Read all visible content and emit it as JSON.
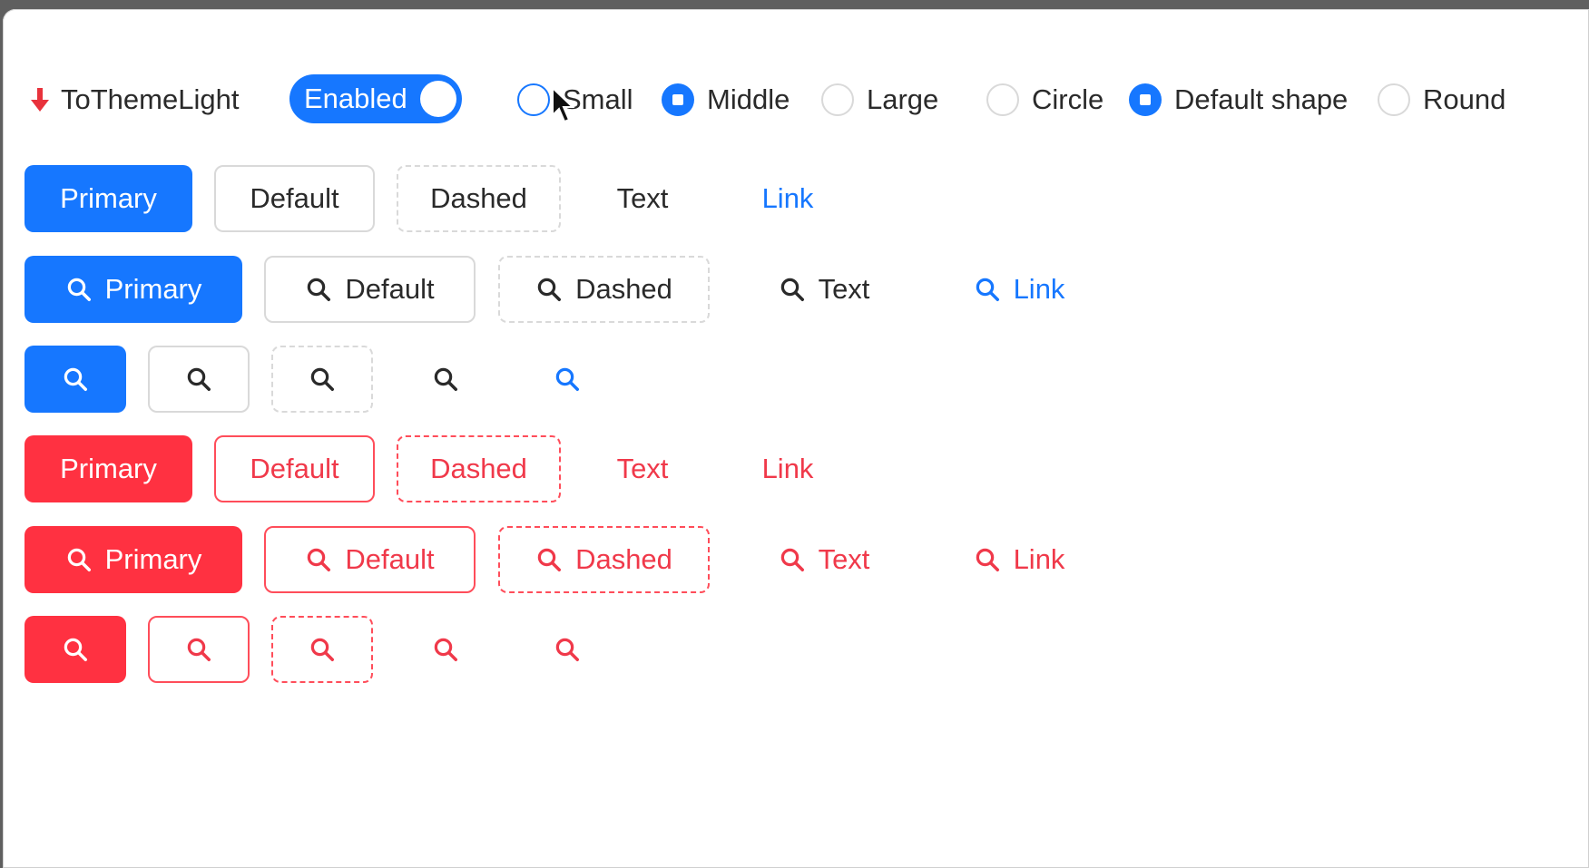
{
  "colors": {
    "primary": "#1677ff",
    "danger": "#ff3141",
    "text": "#2a2a2a",
    "border": "#d9d9d9"
  },
  "controls": {
    "theme_toggle_label": "ToThemeLight",
    "theme_icon": "arrow-down-icon",
    "switch_label": "Enabled",
    "switch_on": true,
    "size_options": [
      {
        "label": "Small",
        "selected": false
      },
      {
        "label": "Middle",
        "selected": true
      },
      {
        "label": "Large",
        "selected": false
      }
    ],
    "shape_options": [
      {
        "label": "Circle",
        "selected": false
      },
      {
        "label": "Default shape",
        "selected": true
      },
      {
        "label": "Round",
        "selected": false
      }
    ]
  },
  "buttons": {
    "primary": "Primary",
    "default": "Default",
    "dashed": "Dashed",
    "text": "Text",
    "link": "Link",
    "icon": "search-icon"
  }
}
